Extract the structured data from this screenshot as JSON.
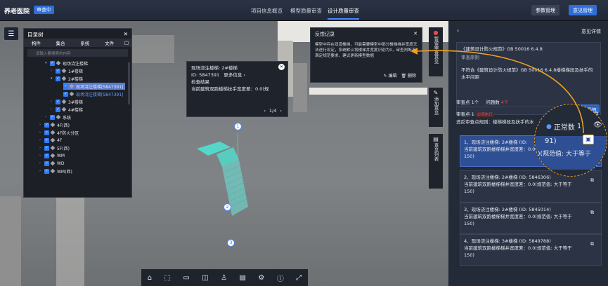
{
  "topbar": {
    "logo": "养老医院",
    "badge": "审查中",
    "nav": [
      "项目信息概览",
      "模型质量审查",
      "设计质量审查"
    ],
    "btn_param": "参数管理",
    "btn_opinion": "意见管理"
  },
  "tree": {
    "title": "目录树",
    "tabs": [
      "构件",
      "集合",
      "系统",
      "文件"
    ],
    "tab_extra": "□",
    "search_placeholder": "请输入要搜索的内容",
    "nodes": [
      "现场浇注楼梯",
      "1#楼梯",
      "2#楼梯",
      "现场浇注楼梯[5847391]",
      "现场浇注楼梯[5847391]",
      "3#楼梯",
      "4#楼梯",
      "系统",
      "4F(西)",
      "4F防火分区",
      "4F",
      "5F(西)",
      "WM",
      "WD",
      "WM(西)"
    ]
  },
  "info_popup": {
    "title": "现场浇注楼梯: 2#楼梯",
    "id_label": "ID: 5847391",
    "more": "更多信息 ›",
    "check_result": "检查结果",
    "check_detail": "当前建筑双跑楼梯扶手宽度差：0.0(规",
    "page": "1/4"
  },
  "feedback": {
    "title": "反馈记录",
    "body": "模型中存在双道楼梯，可能需要模型中部分楼梯梯井宽度无法进行设定，系统默认将楼梯井宽度识别为0，审查判断不满足规范要求，建议更新模型数据",
    "edit": "编辑",
    "delete": "删除"
  },
  "side_buttons": [
    "暂留审查意见",
    "添加意见",
    "意见列表"
  ],
  "right": {
    "header": "意见详情",
    "standard": "《建筑设计防火规范》GB 50016 6.4.8",
    "section_label": "审查原则",
    "violation": "不符合《建筑设计防火规范》GB 50016 6.4.8楼梯梯段及扶手的水平间距",
    "adopt": "采纳",
    "tab_points": "审查点 1个",
    "tab_issues": "问题数",
    "issue_count": "4个",
    "point_title": "审查点 1",
    "point_tag": "必须执行",
    "point_desc": "违反审查点规则：楼梯梯段及扶手的水",
    "normal_label": "正常数",
    "normal_num": "1",
    "items": [
      {
        "title": "1、现场浇注楼梯: 2#楼梯 (ID:",
        "line2": "当前建筑双跑楼梯梯井宽度差：0.0(规范值: 大于等于",
        "line3": "150)"
      },
      {
        "title": "2、现场浇注楼梯: 2#楼梯 (ID: 5846306)",
        "line2": "当前建筑双跑楼梯梯井宽度差：0.0(规范值: 大于等于",
        "line3": "150)"
      },
      {
        "title": "3、现场浇注楼梯: 2#楼梯 (ID: 5845014)",
        "line2": "当前建筑双跑楼梯梯井宽度差：0.0(规范值: 大于等于",
        "line3": "150)"
      },
      {
        "title": "4、现场浇注楼梯: 3#楼梯 (ID: 5849788)",
        "line2": "当前建筑双跑楼梯梯井宽度差：0.0(规范值: 大于等于",
        "line3": "150)"
      }
    ],
    "zoom_text": "91)",
    "zoom_text2": ")(规范值: 大于等于"
  },
  "pins": [
    "1",
    "2",
    "3"
  ],
  "colors": {
    "accent": "#2f6ed8",
    "orange": "#f0a11c",
    "selected": "#2e4f93"
  }
}
